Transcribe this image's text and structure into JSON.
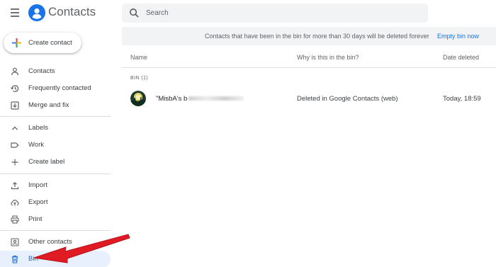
{
  "header": {
    "title": "Contacts",
    "search_placeholder": "Search"
  },
  "sidebar": {
    "create_label": "Create contact",
    "items": [
      {
        "label": "Contacts",
        "icon": "person-icon"
      },
      {
        "label": "Frequently contacted",
        "icon": "history-icon"
      },
      {
        "label": "Merge and fix",
        "icon": "merge-icon"
      },
      {
        "label": "Labels",
        "icon": "chevron-up-icon"
      },
      {
        "label": "Work",
        "icon": "label-icon"
      },
      {
        "label": "Create label",
        "icon": "plus-icon"
      },
      {
        "label": "Import",
        "icon": "upload-icon"
      },
      {
        "label": "Export",
        "icon": "cloud-upload-icon"
      },
      {
        "label": "Print",
        "icon": "printer-icon"
      },
      {
        "label": "Other contacts",
        "icon": "person-add-icon"
      },
      {
        "label": "Bin",
        "icon": "trash-icon",
        "active": true
      }
    ]
  },
  "banner": {
    "text": "Contacts that have been in the bin for more than 30 days will be deleted forever",
    "action": "Empty bin now"
  },
  "table": {
    "columns": [
      "Name",
      "Why is this in the bin?",
      "Date deleted"
    ],
    "section": "BIN (1)",
    "rows": [
      {
        "name": "\"MisbA's b",
        "reason": "Deleted in Google Contacts (web)",
        "date": "Today, 18:59"
      }
    ]
  },
  "colors": {
    "accent": "#1a73e8",
    "active_bg": "#e8f0fe",
    "arrow": "#e01b24"
  }
}
